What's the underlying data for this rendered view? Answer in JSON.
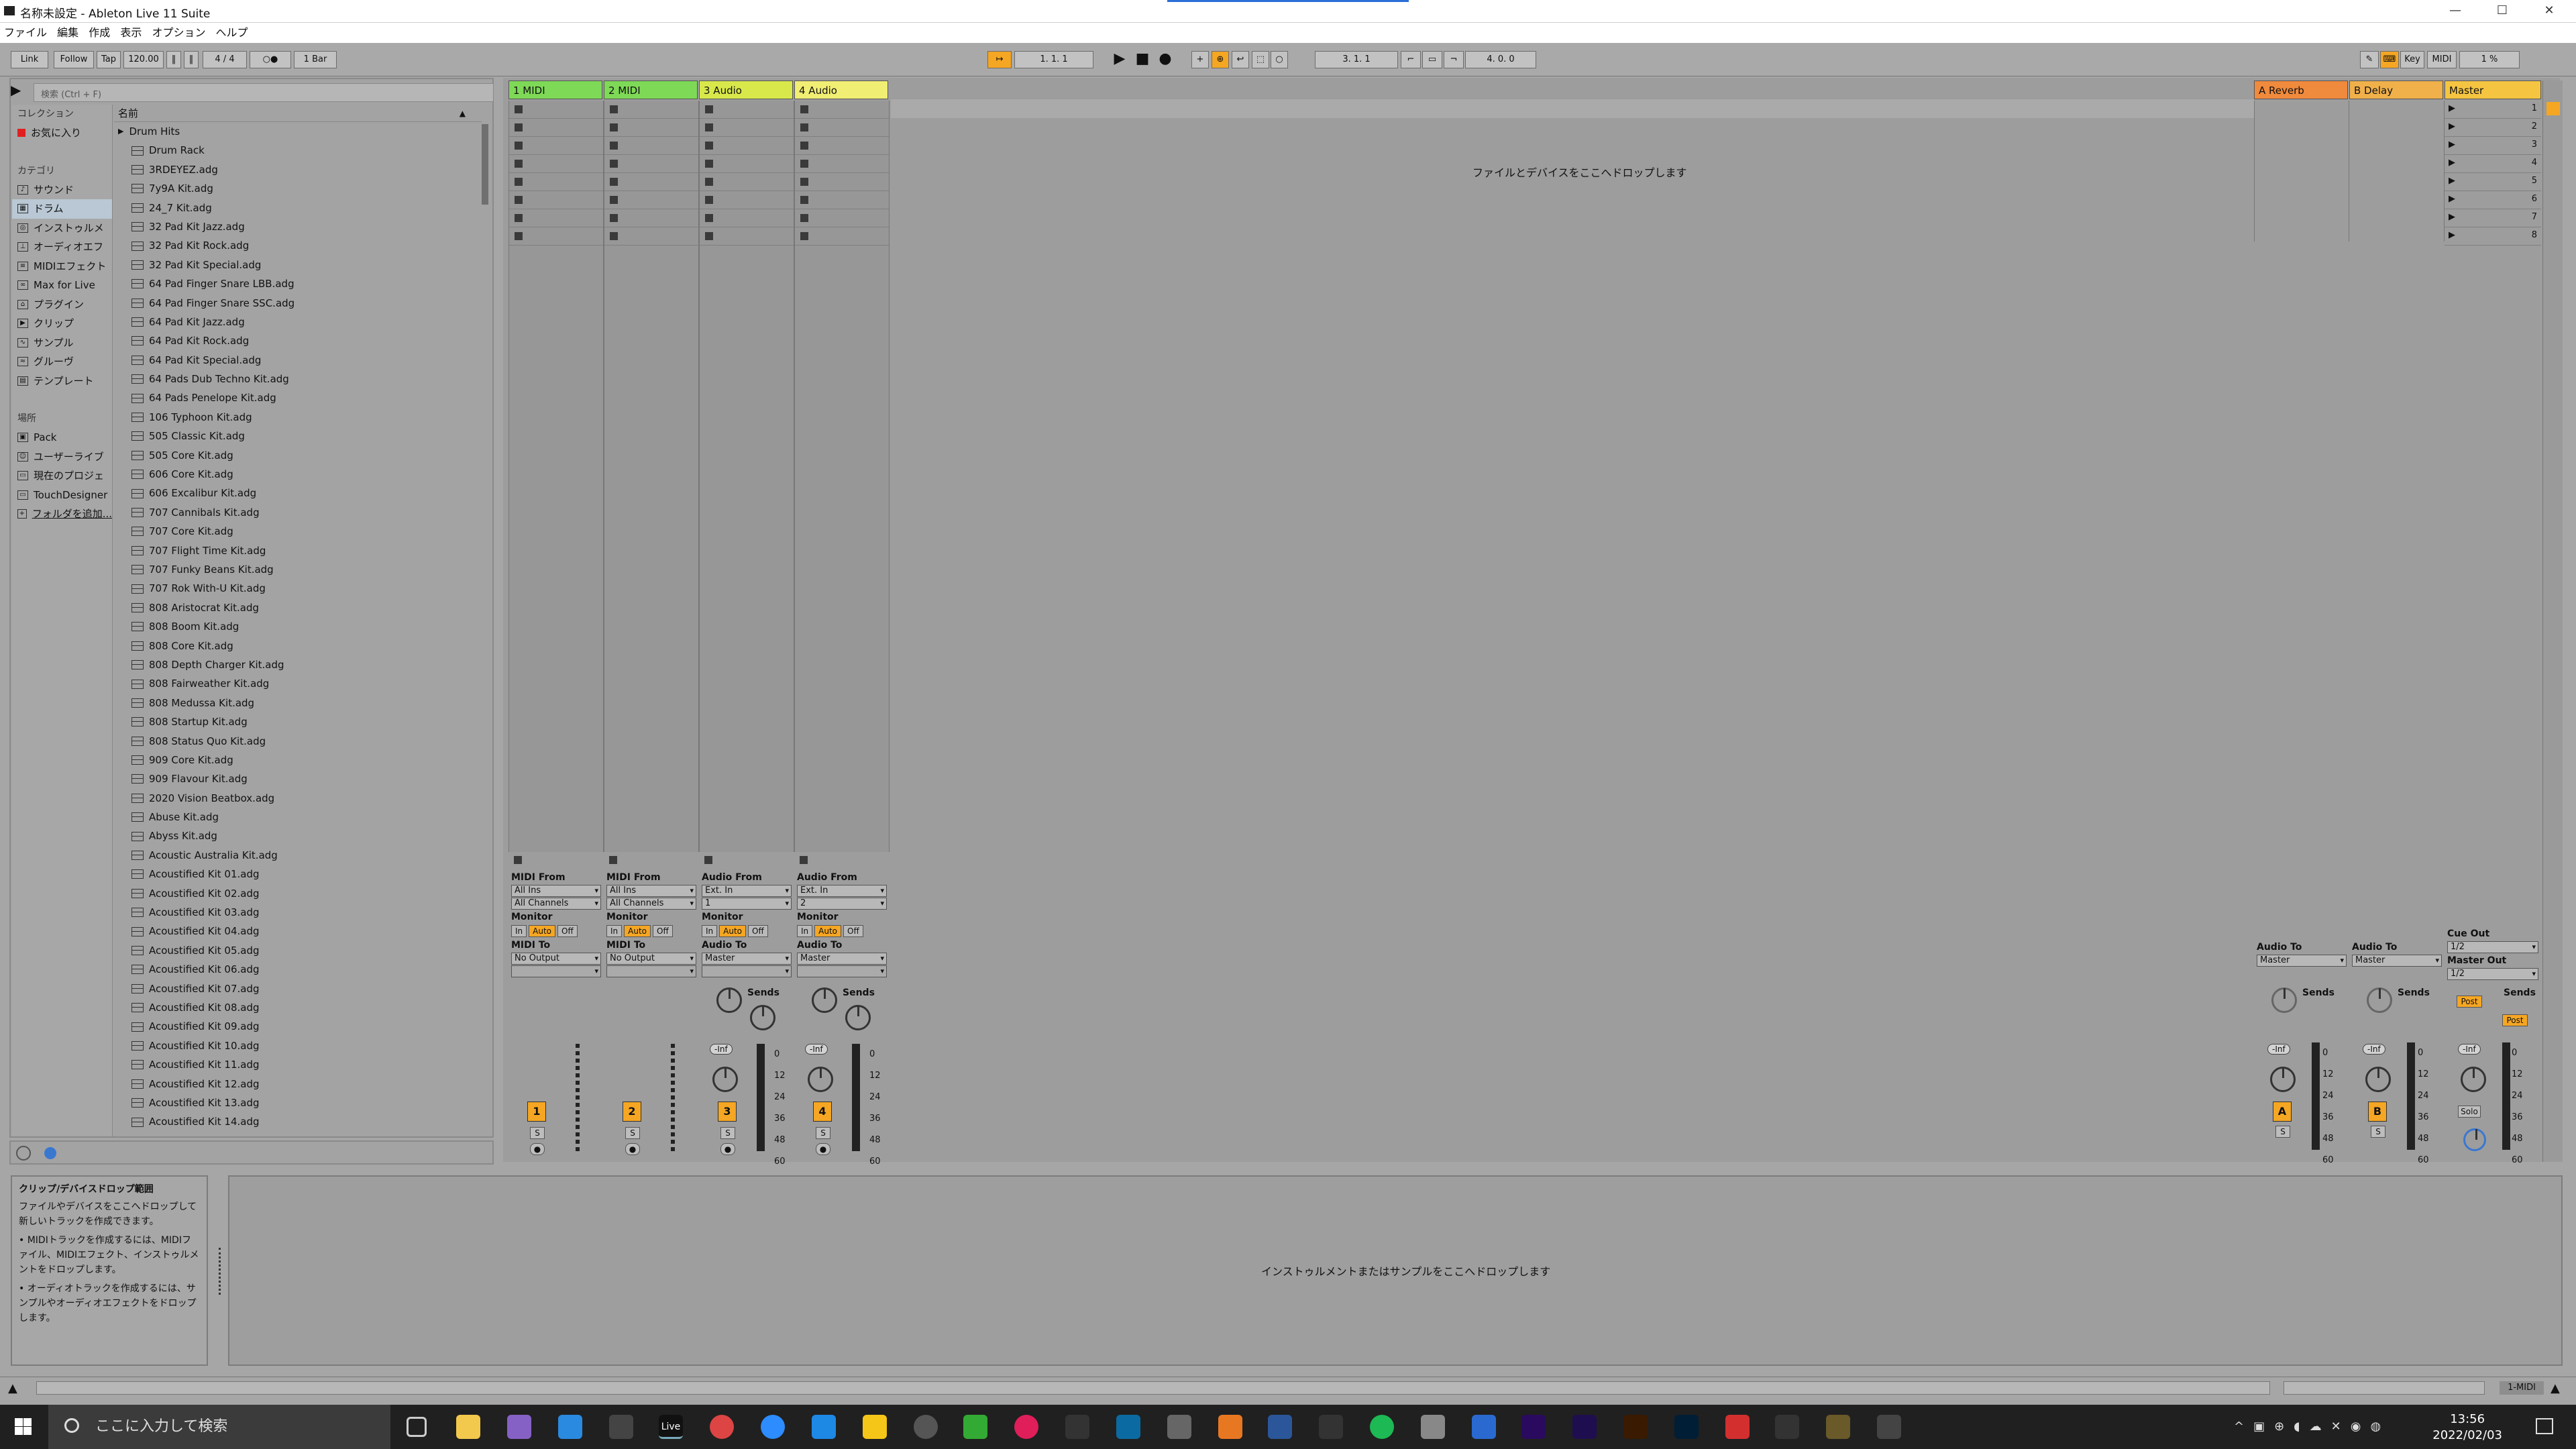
{
  "window": {
    "title": "名称未設定 - Ableton Live 11 Suite",
    "minimize": "—",
    "maximize": "☐",
    "close": "✕"
  },
  "menu": [
    "ファイル",
    "編集",
    "作成",
    "表示",
    "オプション",
    "ヘルプ"
  ],
  "control": {
    "link": "Link",
    "follow": "Follow",
    "tap": "Tap",
    "tempo": "120.00",
    "signature": "4 / 4",
    "quantize": "1 Bar",
    "position": "1.   1.   1",
    "loop_start": "3.   1.   1",
    "loop_len": "4.   0.   0",
    "key": "Key",
    "midi": "MIDI",
    "cpu": "1 %"
  },
  "browser": {
    "search_placeholder": "検索 (Ctrl + F)",
    "collections_header": "コレクション",
    "favorites": "お気に入り",
    "categories_header": "カテゴリ",
    "categories": [
      "サウンド",
      "ドラム",
      "インストゥルメ",
      "オーディオエフ",
      "MIDIエフェクト",
      "Max for Live",
      "プラグイン",
      "クリップ",
      "サンプル",
      "グルーヴ",
      "テンプレート"
    ],
    "places_header": "場所",
    "places": [
      "Pack",
      "ユーザーライブ",
      "現在のプロジェ",
      "TouchDesigner",
      "フォルダを追加..."
    ],
    "list_header": "名前",
    "folder": "Drum Hits",
    "files": [
      "Drum Rack",
      "3RDEYEZ.adg",
      "7y9A Kit.adg",
      "24_7 Kit.adg",
      "32 Pad Kit Jazz.adg",
      "32 Pad Kit Rock.adg",
      "32 Pad Kit Special.adg",
      "64 Pad Finger Snare LBB.adg",
      "64 Pad Finger Snare SSC.adg",
      "64 Pad Kit Jazz.adg",
      "64 Pad Kit Rock.adg",
      "64 Pad Kit Special.adg",
      "64 Pads Dub Techno Kit.adg",
      "64 Pads Penelope Kit.adg",
      "106 Typhoon Kit.adg",
      "505 Classic Kit.adg",
      "505 Core Kit.adg",
      "606 Core Kit.adg",
      "606 Excalibur Kit.adg",
      "707 Cannibals Kit.adg",
      "707 Core Kit.adg",
      "707 Flight Time Kit.adg",
      "707 Funky Beans Kit.adg",
      "707 Rok With-U Kit.adg",
      "808 Aristocrat Kit.adg",
      "808 Boom Kit.adg",
      "808 Core Kit.adg",
      "808 Depth Charger Kit.adg",
      "808 Fairweather Kit.adg",
      "808 Medussa Kit.adg",
      "808 Startup Kit.adg",
      "808 Status Quo Kit.adg",
      "909 Core Kit.adg",
      "909 Flavour Kit.adg",
      "2020 Vision Beatbox.adg",
      "Abuse Kit.adg",
      "Abyss Kit.adg",
      "Acoustic Australia Kit.adg",
      "Acoustified Kit 01.adg",
      "Acoustified Kit 02.adg",
      "Acoustified Kit 03.adg",
      "Acoustified Kit 04.adg",
      "Acoustified Kit 05.adg",
      "Acoustified Kit 06.adg",
      "Acoustified Kit 07.adg",
      "Acoustified Kit 08.adg",
      "Acoustified Kit 09.adg",
      "Acoustified Kit 10.adg",
      "Acoustified Kit 11.adg",
      "Acoustified Kit 12.adg",
      "Acoustified Kit 13.adg",
      "Acoustified Kit 14.adg"
    ]
  },
  "tracks": [
    {
      "name": "1 MIDI",
      "color": "#7ed957",
      "from_label": "MIDI From",
      "from": "All Ins",
      "ch": "All Channels",
      "monitor": "Monitor",
      "to_label": "MIDI To",
      "to": "No Output",
      "num": "1"
    },
    {
      "name": "2 MIDI",
      "color": "#7ed957",
      "from_label": "MIDI From",
      "from": "All Ins",
      "ch": "All Channels",
      "monitor": "Monitor",
      "to_label": "MIDI To",
      "to": "No Output",
      "num": "2"
    },
    {
      "name": "3 Audio",
      "color": "#d8e84a",
      "from_label": "Audio From",
      "from": "Ext. In",
      "ch": "1",
      "monitor": "Monitor",
      "to_label": "Audio To",
      "to": "Master",
      "num": "3"
    },
    {
      "name": "4 Audio",
      "color": "#f1ee74",
      "from_label": "Audio From",
      "from": "Ext. In",
      "ch": "2",
      "monitor": "Monitor",
      "to_label": "Audio To",
      "to": "Master",
      "num": "4"
    }
  ],
  "returns": [
    {
      "name": "A Reverb",
      "color": "#f08a3c",
      "to_label": "Audio To",
      "to": "Master",
      "num": "A"
    },
    {
      "name": "B Delay",
      "color": "#f0b04a",
      "to_label": "Audio To",
      "to": "Master",
      "num": "B"
    }
  ],
  "master": {
    "name": "Master",
    "color": "#f5c542",
    "cue_label": "Cue Out",
    "cue": "1/2",
    "out_label": "Master Out",
    "out": "1/2",
    "post": "Post",
    "solo": "Solo"
  },
  "mixer": {
    "sends": "Sends",
    "in": "In",
    "auto": "Auto",
    "off": "Off",
    "inf": "-Inf",
    "s": "S",
    "db_scale": [
      "0",
      "12",
      "24",
      "36",
      "48",
      "60"
    ],
    "scene_nums": [
      "1",
      "2",
      "3",
      "4",
      "5",
      "6",
      "7",
      "8"
    ]
  },
  "session_drop": "ファイルとデバイスをここへドロップします",
  "info": {
    "title": "クリップ/デバイスドロップ範囲",
    "body": "ファイルやデバイスをここへドロップして新しいトラックを作成できます。",
    "b1": "• MIDIトラックを作成するには、MIDIファイル、MIDIエフェクト、インストゥルメントをドロップします。",
    "b2": "• オーディオトラックを作成するには、サンプルやオーディオエフェクトをドロップします。"
  },
  "detail_drop": "インストゥルメントまたはサンプルをここへドロップします",
  "status": {
    "track": "1-MIDI"
  },
  "taskbar": {
    "search": "ここに入力して検索",
    "time": "13:56",
    "date": "2022/02/03"
  }
}
